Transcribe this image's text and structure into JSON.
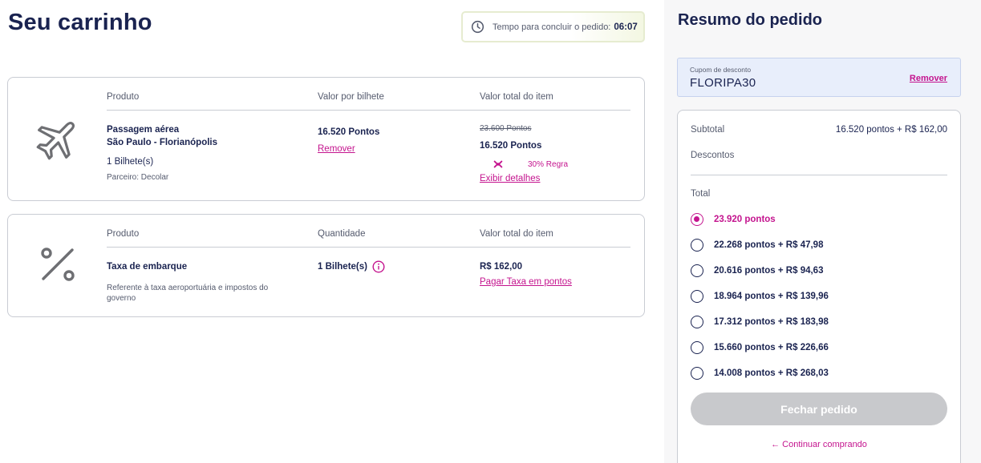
{
  "page": {
    "title": "Seu carrinho"
  },
  "timer": {
    "label": "Tempo para concluir o pedido:",
    "value": "06:07"
  },
  "items": [
    {
      "icon": "airplane-icon",
      "headers": [
        "Produto",
        "Valor por bilhete",
        "Valor total do item"
      ],
      "product_name_line1": "Passagem aérea",
      "product_name_line2": "São Paulo - Florianópolis",
      "quantity": "1 Bilhete(s)",
      "partner": "Parceiro: Decolar",
      "unit_value": "16.520 Pontos",
      "remove_label": "Remover",
      "original_total": "23.600 Pontos",
      "total": "16.520 Pontos",
      "rule_tag": "30% Regra",
      "details_link": "Exibir detalhes"
    },
    {
      "icon": "percent-icon",
      "headers": [
        "Produto",
        "Quantidade",
        "Valor total do item"
      ],
      "product_name": "Taxa de embarque",
      "description": "Referente à taxa aeroportuária e impostos do governo",
      "quantity": "1 Bilhete(s)",
      "total": "R$ 162,00",
      "pay_link": "Pagar Taxa em pontos"
    }
  ],
  "summary": {
    "title": "Resumo do pedido",
    "coupon": {
      "label": "Cupom de desconto",
      "code": "FLORIPA30",
      "remove_label": "Remover"
    },
    "subtotal_label": "Subtotal",
    "subtotal_value": "16.520 pontos + R$ 162,00",
    "discounts_label": "Descontos",
    "total_label": "Total",
    "options": [
      "23.920 pontos",
      "22.268 pontos + R$ 47,98",
      "20.616 pontos + R$ 94,63",
      "18.964 pontos + R$ 139,96",
      "17.312 pontos + R$ 183,98",
      "15.660 pontos + R$ 226,66",
      "14.008 pontos + R$ 268,03"
    ],
    "selected_option": "23.920 pontos",
    "close_button": "Fechar pedido",
    "continue_link": "← Continuar comprando"
  },
  "colors": {
    "brand_navy": "#1a2350",
    "accent_magenta": "#c4148e",
    "disabled_gray": "#c8c9cc",
    "coupon_bg": "#e8eefb"
  }
}
